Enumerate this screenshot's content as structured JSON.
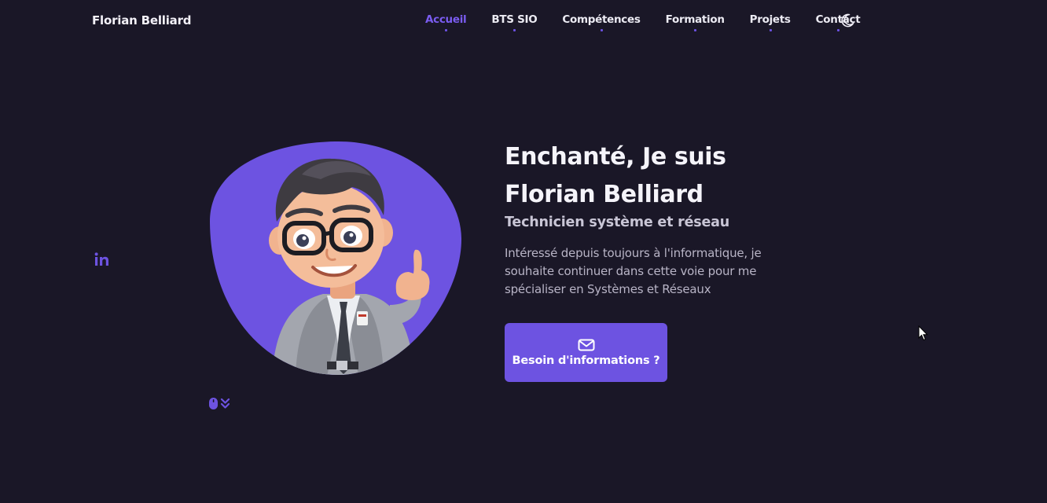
{
  "header": {
    "logo": "Florian Belliard",
    "nav": [
      {
        "label": "Accueil",
        "active": true
      },
      {
        "label": "BTS SIO"
      },
      {
        "label": "Compétences"
      },
      {
        "label": "Formation"
      },
      {
        "label": "Projets"
      },
      {
        "label": "Contact"
      }
    ],
    "theme_icon": "moon-icon"
  },
  "hero": {
    "title_line1": "Enchanté, Je suis",
    "title_line2": "Florian Belliard",
    "subtitle": "Technicien système et réseau",
    "description": "Intéressé depuis toujours à l'informatique, je souhaite continuer dans cette voie pour me spécialiser en Systèmes et Réseaux",
    "cta_label": "Besoin d'informations ?",
    "cta_icon": "mail-icon",
    "social_icon": "linkedin-icon",
    "scroll_icon": "mouse-scroll-icon"
  },
  "colors": {
    "background": "#1a1727",
    "accent": "#6d53e1",
    "text": "#f5f4fa",
    "muted": "#b8b4c6"
  }
}
